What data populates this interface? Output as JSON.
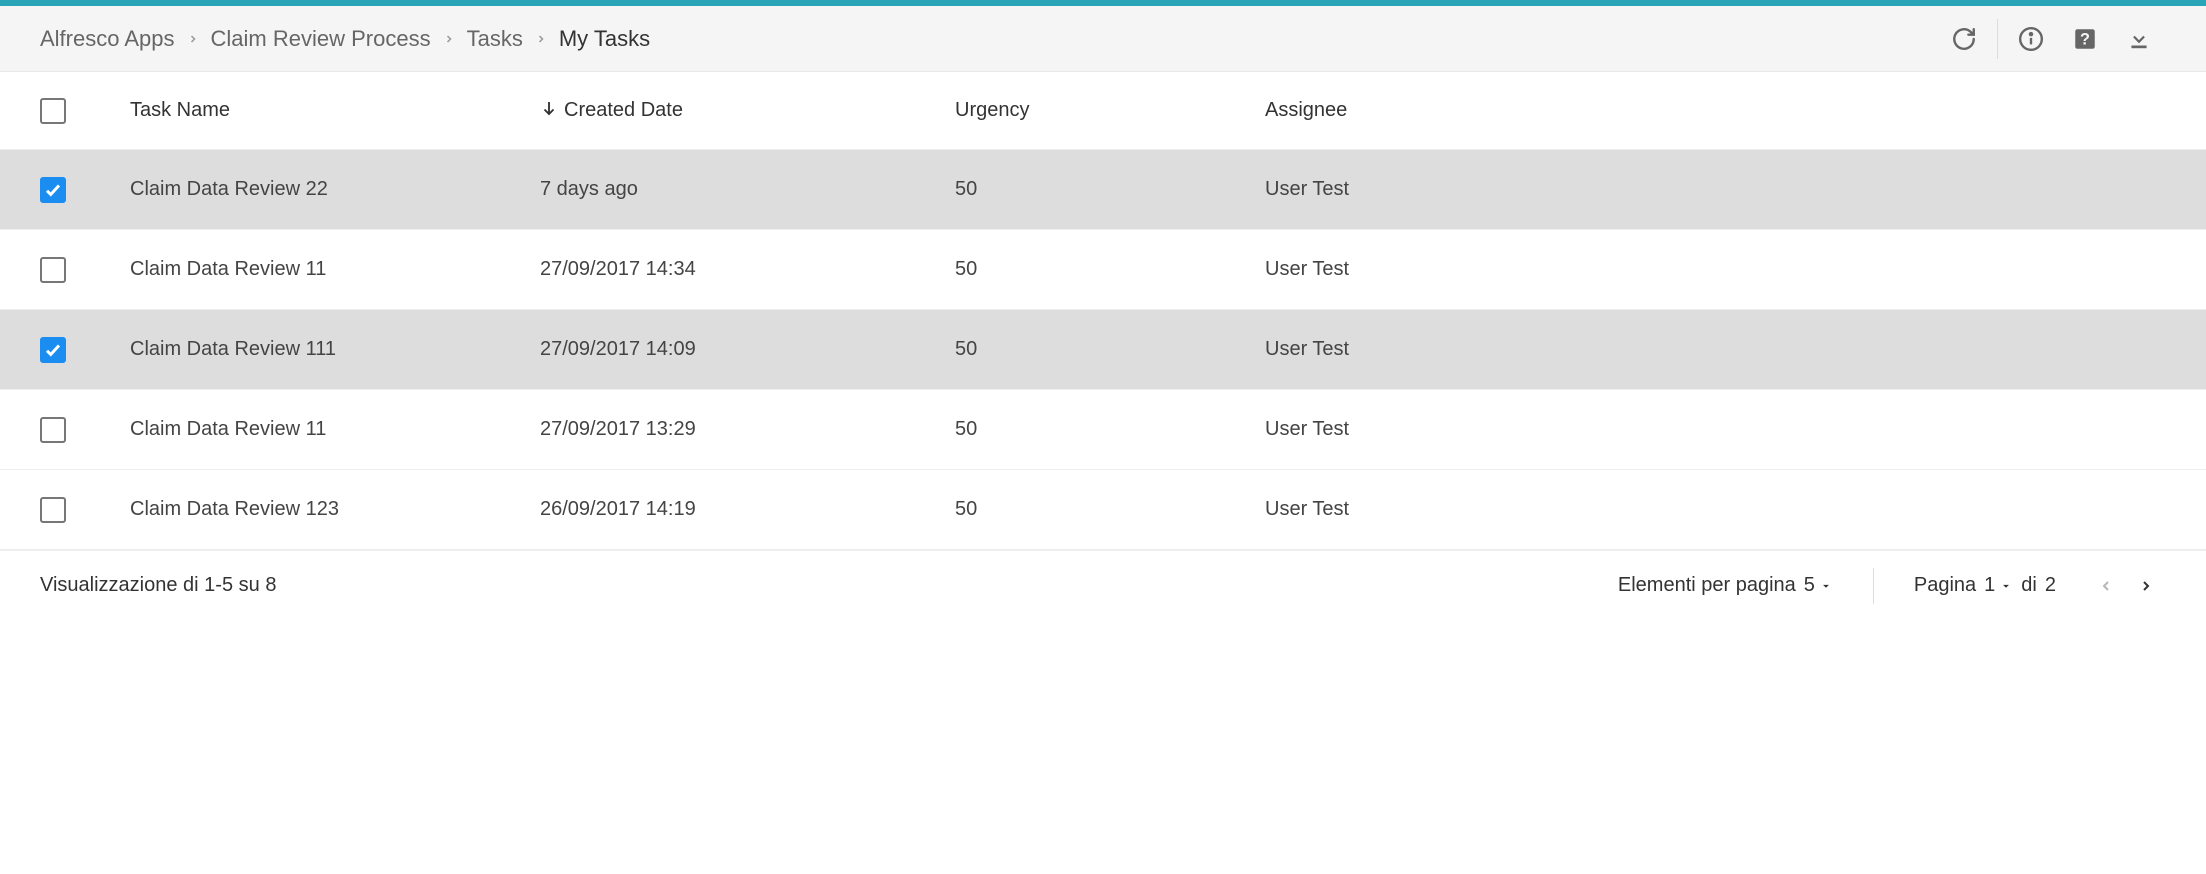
{
  "breadcrumb": [
    "Alfresco Apps",
    "Claim Review Process",
    "Tasks",
    "My Tasks"
  ],
  "columns": {
    "task_name": "Task Name",
    "created_date": "Created Date",
    "urgency": "Urgency",
    "assignee": "Assignee"
  },
  "rows": [
    {
      "selected": true,
      "task_name": "Claim Data Review 22",
      "created_date": "7 days ago",
      "urgency": "50",
      "assignee": "User Test"
    },
    {
      "selected": false,
      "task_name": "Claim Data Review 11",
      "created_date": "27/09/2017 14:34",
      "urgency": "50",
      "assignee": "User Test"
    },
    {
      "selected": true,
      "task_name": "Claim Data Review 111",
      "created_date": "27/09/2017 14:09",
      "urgency": "50",
      "assignee": "User Test"
    },
    {
      "selected": false,
      "task_name": "Claim Data Review 11",
      "created_date": "27/09/2017 13:29",
      "urgency": "50",
      "assignee": "User Test"
    },
    {
      "selected": false,
      "task_name": "Claim Data Review 123",
      "created_date": "26/09/2017 14:19",
      "urgency": "50",
      "assignee": "User Test"
    }
  ],
  "footer": {
    "summary": "Visualizzazione di 1-5 su 8",
    "per_page_label": "Elementi per pagina",
    "per_page_value": "5",
    "page_label": "Pagina",
    "page_value": "1",
    "page_of_label": "di",
    "page_total": "2"
  }
}
